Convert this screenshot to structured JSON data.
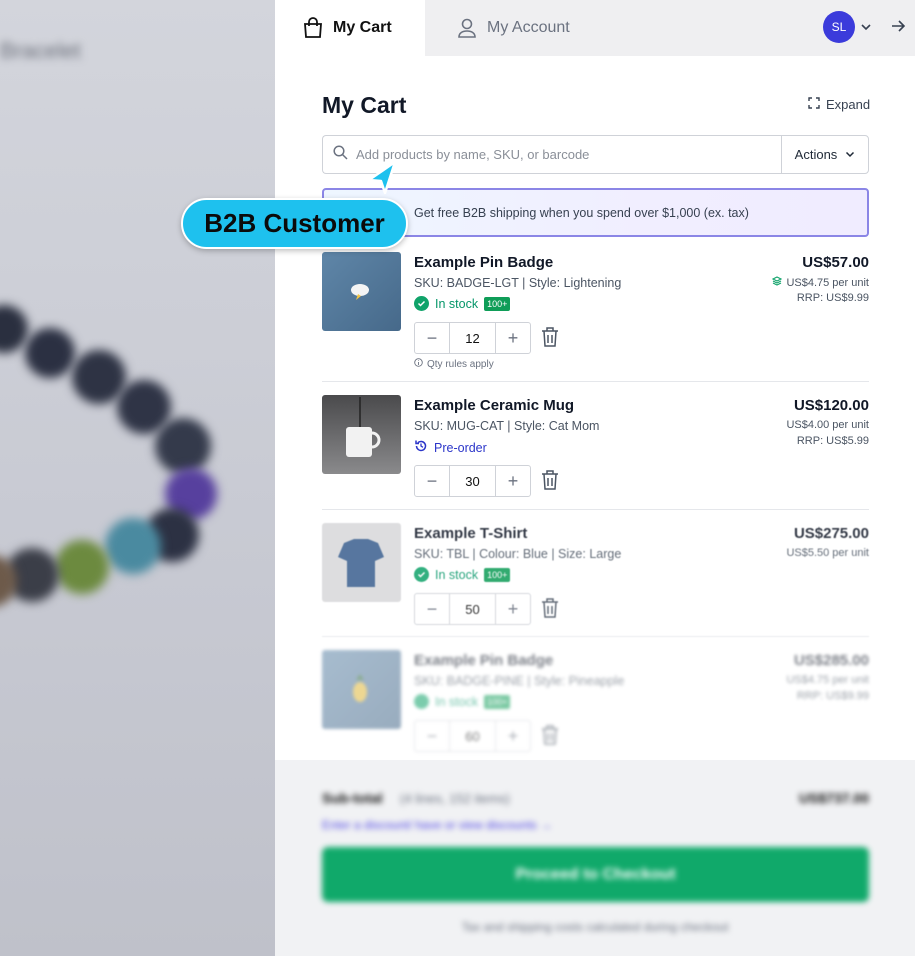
{
  "background": {
    "store_title": "Bracelet"
  },
  "tabs": [
    {
      "label": "My Cart",
      "icon": "bag-icon"
    },
    {
      "label": "My Account",
      "icon": "user-icon"
    }
  ],
  "user": {
    "initials": "SL"
  },
  "cart": {
    "title": "My Cart",
    "expand_label": "Expand",
    "search_placeholder": "Add products by name, SKU, or barcode",
    "actions_label": "Actions",
    "banner_text": "Get free B2B shipping when you spend over $1,000 (ex. tax)",
    "qty_rules": "Qty rules apply",
    "items": [
      {
        "name": "Example Pin Badge",
        "sku": "SKU: BADGE-LGT | Style: Lightening",
        "stock": "In stock",
        "stock_badge": "100+",
        "qty": "12",
        "price": "US$57.00",
        "unit": "US$4.75 per unit",
        "rrp": "RRP: US$9.99"
      },
      {
        "name": "Example Ceramic Mug",
        "sku": "SKU: MUG-CAT | Style: Cat Mom",
        "stock": "Pre-order",
        "qty": "30",
        "price": "US$120.00",
        "unit": "US$4.00 per unit",
        "rrp": "RRP: US$5.99"
      },
      {
        "name": "Example T-Shirt",
        "sku": "SKU: TBL | Colour: Blue | Size: Large",
        "stock": "In stock",
        "stock_badge": "100+",
        "qty": "50",
        "price": "US$275.00",
        "unit": "US$5.50 per unit"
      },
      {
        "name": "Example Pin Badge",
        "sku": "SKU: BADGE-PINE | Style: Pineapple",
        "stock": "In stock",
        "stock_badge": "100+",
        "qty": "60",
        "price": "US$285.00",
        "unit": "US$4.75 per unit",
        "rrp": "RRP: US$9.99"
      }
    ]
  },
  "footer": {
    "subtotal_label": "Sub-total",
    "subtotal_count": "(4 lines, 152 items)",
    "subtotal_amount": "US$737.00",
    "discount_link": "Enter a discount/ have or view discounts →",
    "checkout_label": "Proceed to Checkout",
    "footnote": "Tax and shipping costs calculated during checkout"
  },
  "overlay": {
    "label": "B2B Customer"
  },
  "colors": {
    "accent": "#1ec1ee",
    "checkout": "#10a96a",
    "avatar": "#3b3bdb",
    "stock": "#059669",
    "preorder": "#2b35c9"
  }
}
